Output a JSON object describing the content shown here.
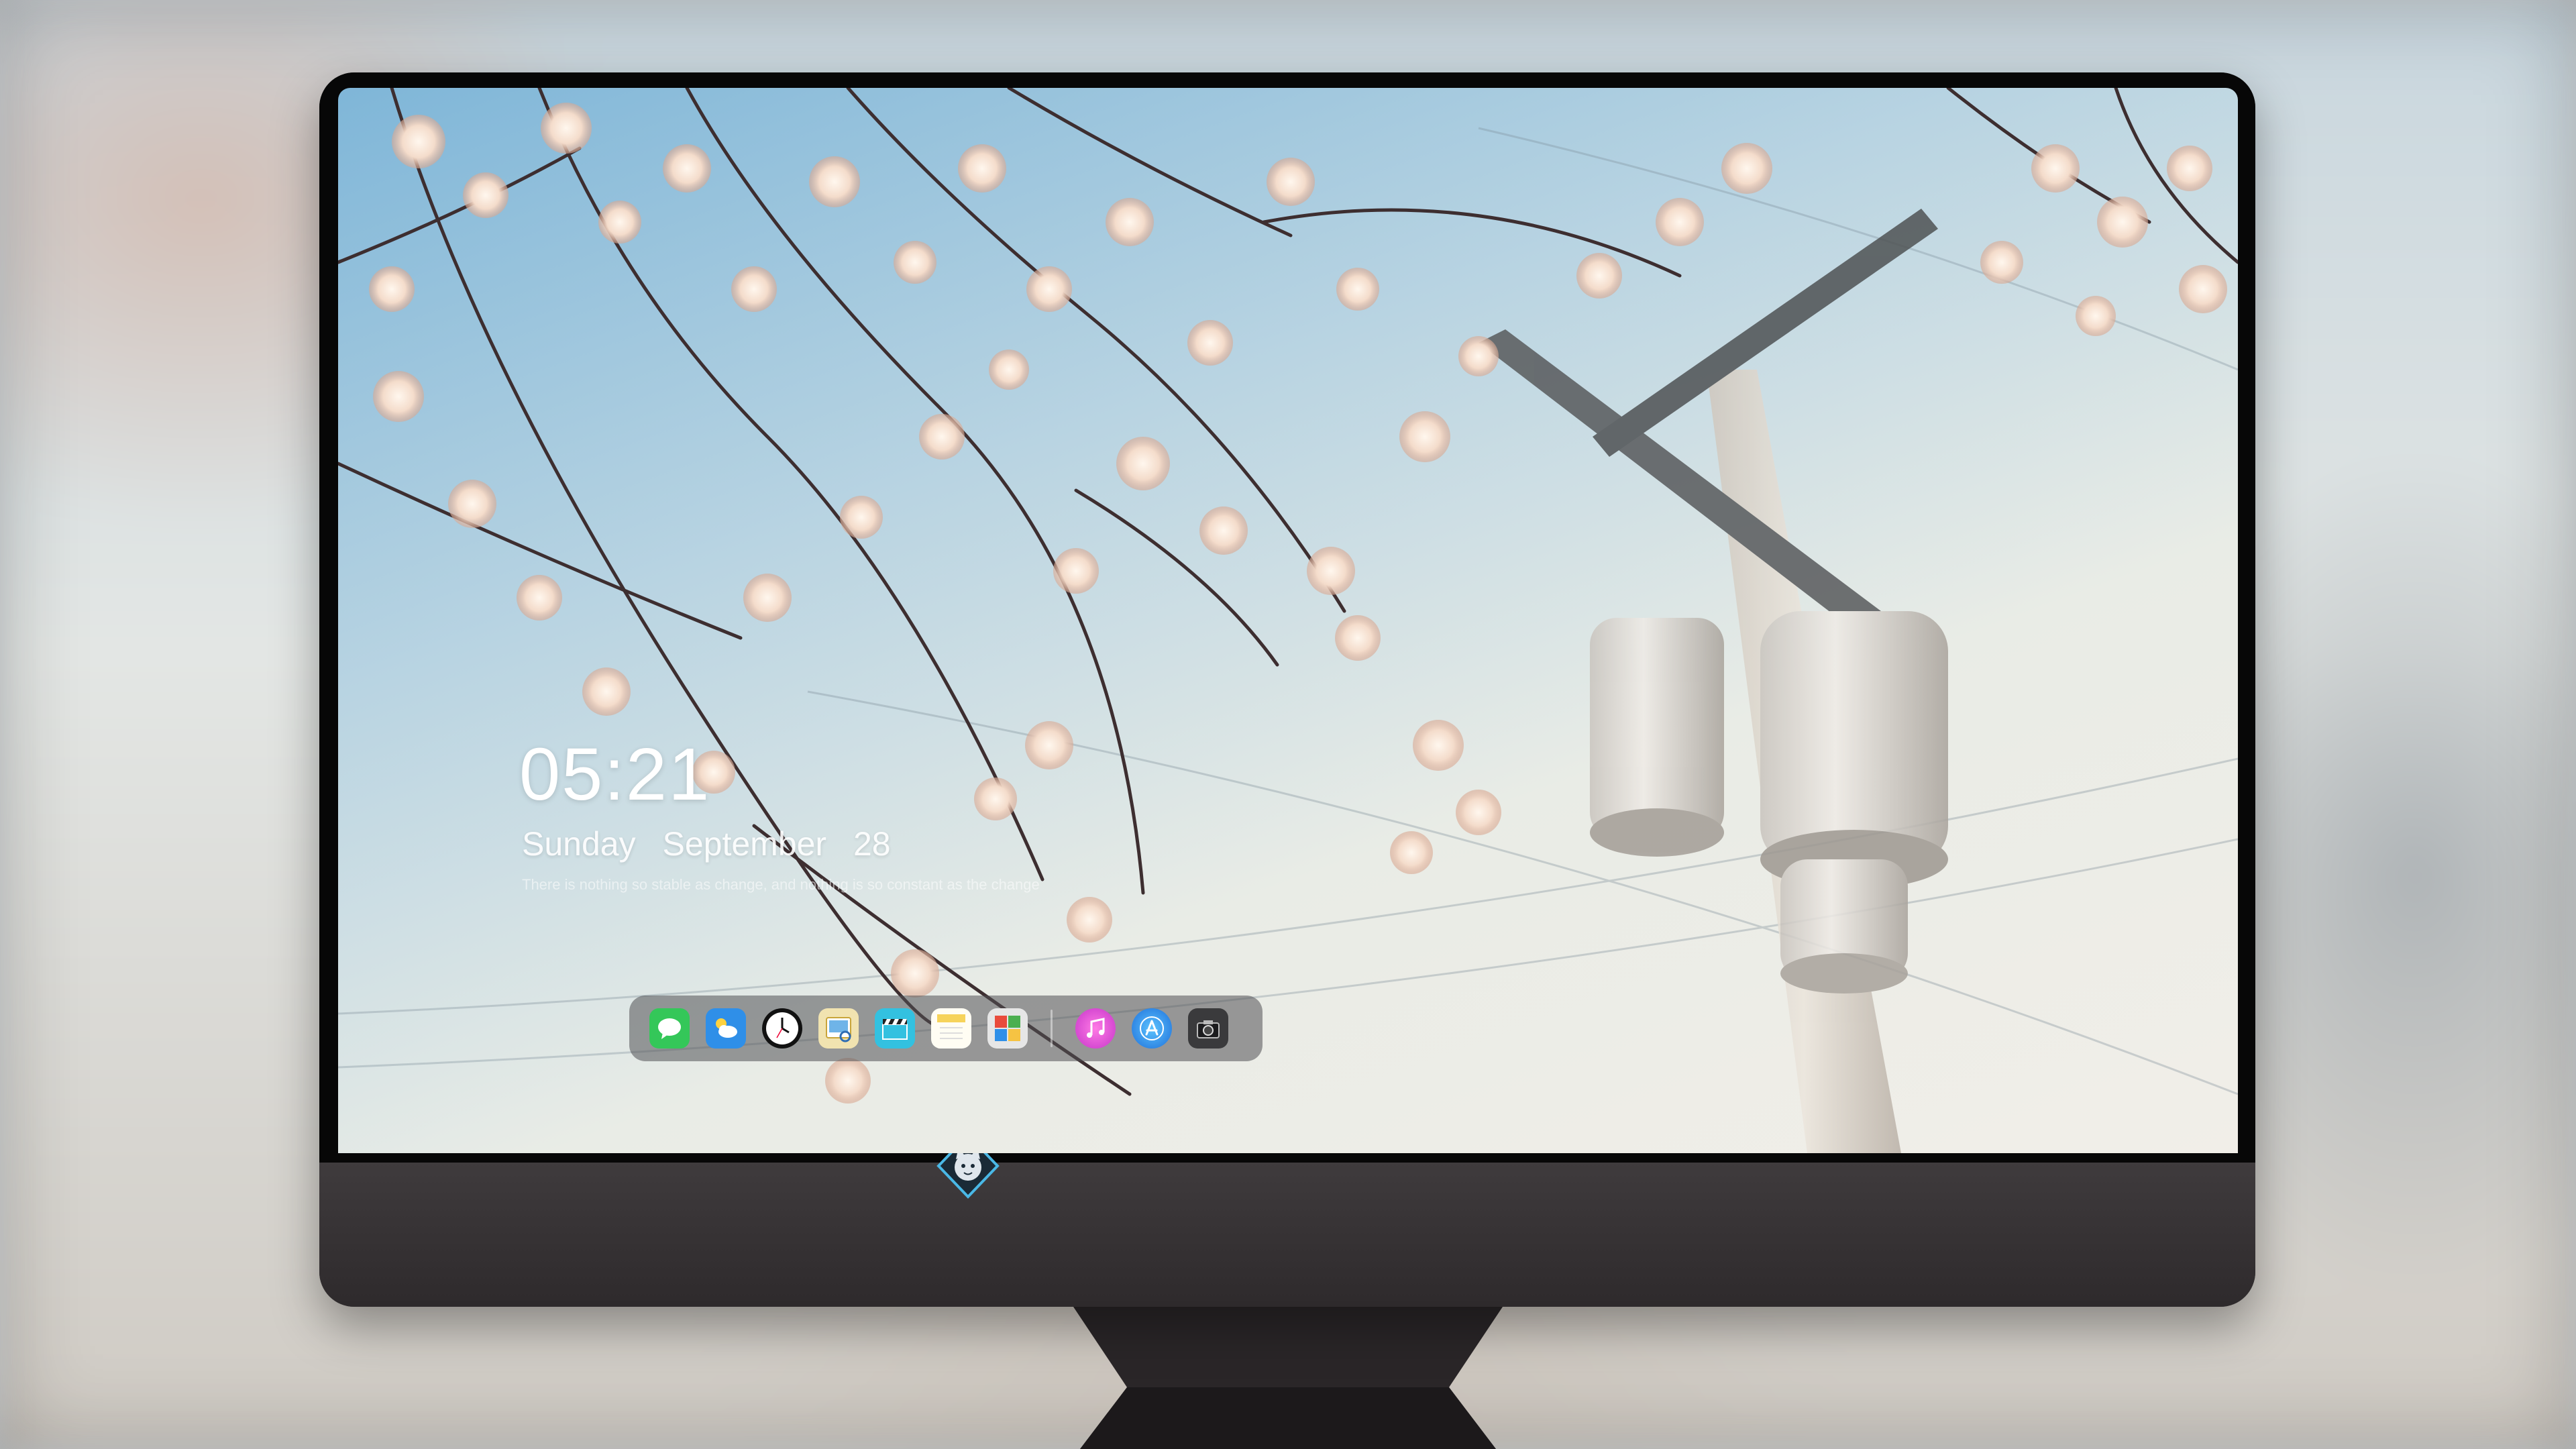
{
  "lock_screen": {
    "time": "05:21",
    "date": {
      "weekday": "Sunday",
      "month": "September",
      "day": "28"
    },
    "quote": "There is nothing so stable as change, and nothing is so constant as the change"
  },
  "dock": {
    "apps": [
      {
        "name": "messages",
        "icon": "message-bubble-icon",
        "color": "#34c759"
      },
      {
        "name": "weather",
        "icon": "cloud-sun-icon",
        "color": "#2f8fe8"
      },
      {
        "name": "clock",
        "icon": "clock-icon",
        "color": "#111111"
      },
      {
        "name": "preview",
        "icon": "photo-viewer-icon",
        "color": "#e8c14a"
      },
      {
        "name": "video-editor",
        "icon": "clapperboard-icon",
        "color": "#33c1e0"
      },
      {
        "name": "notes",
        "icon": "notepad-icon",
        "color": "#f6d35a"
      },
      {
        "name": "photo-booth",
        "icon": "photo-grid-icon",
        "color": "#e6e6e6"
      },
      {
        "name": "music",
        "icon": "music-note-icon",
        "color": "#e64fd6"
      },
      {
        "name": "app-store",
        "icon": "app-store-icon",
        "color": "#1e90ff"
      },
      {
        "name": "camera",
        "icon": "camera-icon",
        "color": "#3a3a3c"
      }
    ]
  },
  "colors": {
    "monitor_body": "#3a3638",
    "bezel": "#070707",
    "dock_background": "rgba(80,80,84,0.55)"
  }
}
